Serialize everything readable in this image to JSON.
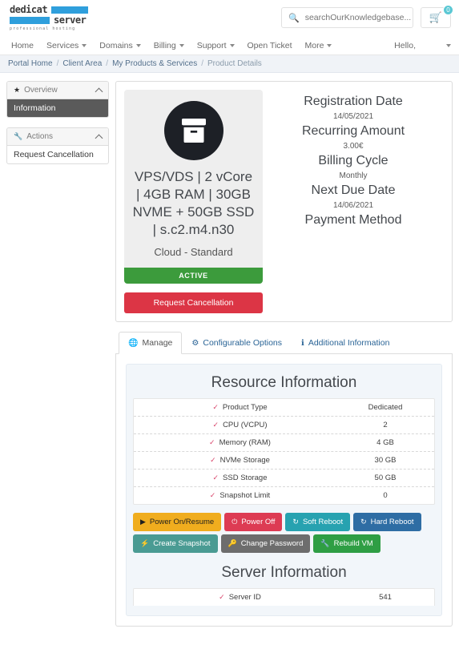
{
  "header": {
    "logo": {
      "word1": "dedicat",
      "word2": "server",
      "tagline": "professional hosting"
    },
    "search": {
      "placeholder": "searchOurKnowledgebase...",
      "value": "",
      "icon": "search-icon"
    },
    "cart": {
      "icon": "cart-icon",
      "badge": "0"
    }
  },
  "nav": {
    "items": [
      {
        "label": "Home",
        "caret": false
      },
      {
        "label": "Services",
        "caret": true
      },
      {
        "label": "Domains",
        "caret": true
      },
      {
        "label": "Billing",
        "caret": true
      },
      {
        "label": "Support",
        "caret": true
      },
      {
        "label": "Open Ticket",
        "caret": false
      },
      {
        "label": "More",
        "caret": true
      }
    ],
    "account": {
      "label": "Hello,",
      "caret": true
    }
  },
  "breadcrumb": {
    "items": [
      "Portal Home",
      "Client Area",
      "My Products & Services",
      "Product Details"
    ],
    "separator": "/"
  },
  "sidebar": {
    "panels": [
      {
        "title": "Overview",
        "icon": "star-icon",
        "collapse_icon": "chevron-up-icon",
        "items": [
          {
            "label": "Information",
            "active": true
          }
        ]
      },
      {
        "title": "Actions",
        "icon": "wrench-icon",
        "collapse_icon": "chevron-up-icon",
        "items": [
          {
            "label": "Request Cancellation",
            "active": false
          }
        ]
      }
    ]
  },
  "product": {
    "icon": "archive-box-icon",
    "name": "VPS/VDS | 2 vCore | 4GB RAM | 30GB NVME + 50GB SSD | s.c2.m4.n30",
    "group": "Cloud - Standard",
    "status": "ACTIVE",
    "status_color": "#3c9b3c",
    "cancel_label": "Request Cancellation",
    "cancel_color": "#dc3545"
  },
  "details": [
    {
      "label": "Registration Date",
      "value": "14/05/2021"
    },
    {
      "label": "Recurring Amount",
      "value": "3.00€"
    },
    {
      "label": "Billing Cycle",
      "value": "Monthly"
    },
    {
      "label": "Next Due Date",
      "value": "14/06/2021"
    },
    {
      "label": "Payment Method",
      "value": ""
    }
  ],
  "tabs": [
    {
      "label": "Manage",
      "icon": "globe-icon",
      "active": true
    },
    {
      "label": "Configurable Options",
      "icon": "sliders-icon",
      "active": false
    },
    {
      "label": "Additional Information",
      "icon": "info-icon",
      "active": false
    }
  ],
  "resource_section": {
    "title": "Resource Information",
    "rows": [
      {
        "label": "Product Type",
        "value": "Dedicated"
      },
      {
        "label": "CPU (VCPU)",
        "value": "2"
      },
      {
        "label": "Memory (RAM)",
        "value": "4 GB"
      },
      {
        "label": "NVMe Storage",
        "value": "30 GB"
      },
      {
        "label": "SSD Storage",
        "value": "50 GB"
      },
      {
        "label": "Snapshot Limit",
        "value": "0"
      }
    ]
  },
  "actions": [
    {
      "label": "Power On/Resume",
      "icon": "play-icon",
      "color": "#f0ad1e",
      "text_color": "#1f1f1f"
    },
    {
      "label": "Power Off",
      "icon": "power-icon",
      "color": "#dd3b53",
      "text_color": "#ffffff"
    },
    {
      "label": "Soft Reboot",
      "icon": "refresh-icon",
      "color": "#27a2b0",
      "text_color": "#ffffff"
    },
    {
      "label": "Hard Reboot",
      "icon": "refresh-icon",
      "color": "#2e6da4",
      "text_color": "#ffffff"
    },
    {
      "label": "Create Snapshot",
      "icon": "bolt-icon",
      "color": "#4a9b93",
      "text_color": "#ffffff"
    },
    {
      "label": "Change Password",
      "icon": "key-icon",
      "color": "#6d6d6d",
      "text_color": "#ffffff"
    },
    {
      "label": "Rebuild VM",
      "icon": "wrench-icon",
      "color": "#2f9e44",
      "text_color": "#ffffff"
    }
  ],
  "server_section": {
    "title": "Server Information",
    "rows": [
      {
        "label": "Server ID",
        "value": "541"
      }
    ]
  }
}
